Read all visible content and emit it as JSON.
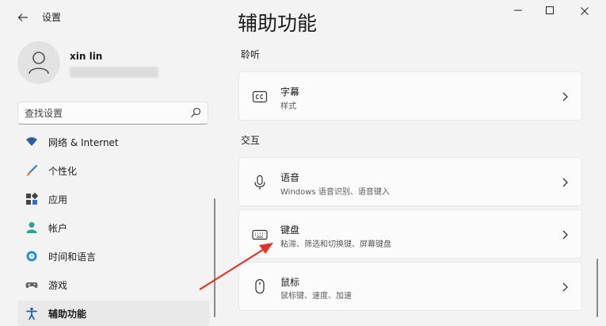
{
  "window": {
    "app_title": "设置",
    "back_icon": "back-arrow-icon"
  },
  "profile": {
    "user_name": "xin lin"
  },
  "search": {
    "placeholder": "查找设置"
  },
  "sidebar": {
    "items": [
      {
        "label": "网络 & Internet",
        "icon": "wifi-icon",
        "active": false
      },
      {
        "label": "个性化",
        "icon": "brush-icon",
        "active": false
      },
      {
        "label": "应用",
        "icon": "apps-icon",
        "active": false
      },
      {
        "label": "帐户",
        "icon": "account-icon",
        "active": false
      },
      {
        "label": "时间和语言",
        "icon": "globe-clock-icon",
        "active": false
      },
      {
        "label": "游戏",
        "icon": "gamepad-icon",
        "active": false
      },
      {
        "label": "辅助功能",
        "icon": "accessibility-icon",
        "active": true
      }
    ]
  },
  "main": {
    "page_title": "辅助功能",
    "sections": [
      {
        "label": "聆听",
        "cards": [
          {
            "title": "字幕",
            "subtitle": "样式",
            "icon": "cc-icon"
          }
        ]
      },
      {
        "label": "交互",
        "cards": [
          {
            "title": "语音",
            "subtitle": "Windows 语音识别、语音键入",
            "icon": "microphone-icon"
          },
          {
            "title": "键盘",
            "subtitle": "粘滞、筛选和切换键、屏幕键盘",
            "icon": "keyboard-icon"
          },
          {
            "title": "鼠标",
            "subtitle": "鼠标键、速度、加速",
            "icon": "mouse-icon"
          }
        ]
      }
    ]
  },
  "colors": {
    "accent": "#0067c0",
    "background": "#f3f3f3",
    "card": "#fbfbfb",
    "annotation_arrow": "#e8302a"
  }
}
